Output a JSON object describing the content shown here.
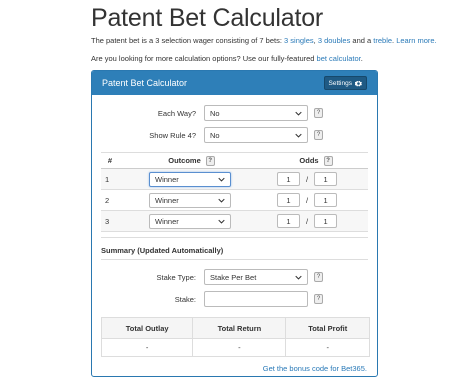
{
  "page": {
    "title": "Patent Bet Calculator",
    "intro": {
      "prefix": "The patent bet is a 3 selection wager consisting of 7 bets: ",
      "singles_link": "3 singles",
      "sep1": ", ",
      "doubles_link": "3 doubles",
      "sep2": " and a ",
      "treble_link": "treble",
      "sep3": ". ",
      "learn_more": "Learn more."
    },
    "options": {
      "prefix": "Are you looking for more calculation options? Use our fully-featured ",
      "link": "bet calculator",
      "suffix": "."
    }
  },
  "calculator": {
    "header_title": "Patent Bet Calculator",
    "settings_label": "Settings",
    "each_way": {
      "label": "Each Way?",
      "value": "No"
    },
    "rule4": {
      "label": "Show Rule 4?",
      "value": "No"
    },
    "help_label": "?",
    "table": {
      "col_num": "#",
      "col_outcome": "Outcome",
      "col_odds": "Odds",
      "odds_sep": "/",
      "rows": [
        {
          "num": "1",
          "outcome": "Winner",
          "odds_num": "1",
          "odds_den": "1"
        },
        {
          "num": "2",
          "outcome": "Winner",
          "odds_num": "1",
          "odds_den": "1"
        },
        {
          "num": "3",
          "outcome": "Winner",
          "odds_num": "1",
          "odds_den": "1"
        }
      ]
    },
    "summary": {
      "title": "Summary (Updated Automatically)",
      "stake_type": {
        "label": "Stake Type:",
        "value": "Stake Per Bet"
      },
      "stake": {
        "label": "Stake:",
        "value": ""
      },
      "headers": [
        "Total Outlay",
        "Total Return",
        "Total Profit"
      ],
      "values": [
        "-",
        "-",
        "-"
      ]
    },
    "bonus_link": "Get the bonus code for Bet365."
  },
  "colors": {
    "header": "#2e7fb8",
    "link": "#2a7ab8",
    "settings_bg": "#1f5a84"
  },
  "icons": {
    "settings": "gear-icon",
    "dropdown": "chevron-down-icon",
    "help": "help-icon"
  }
}
